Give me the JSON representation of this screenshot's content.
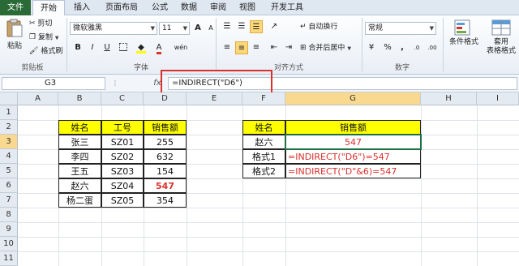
{
  "ribbon_tabs": [
    "文件",
    "开始",
    "插入",
    "页面布局",
    "公式",
    "数据",
    "审阅",
    "视图",
    "开发工具"
  ],
  "clipboard": {
    "paste": "粘贴",
    "cut": "剪切",
    "copy": "复制",
    "format_painter": "格式刷",
    "group_label": "剪贴板"
  },
  "font": {
    "name": "微软雅黑",
    "size": "11",
    "bold": "B",
    "italic": "I",
    "underline": "U",
    "grow": "A",
    "shrink": "A",
    "font_color_glyph": "A",
    "phonetic": "wén",
    "group_label": "字体"
  },
  "alignment": {
    "wrap": "自动换行",
    "merge": "合并后居中",
    "group_label": "对齐方式"
  },
  "number": {
    "format": "常规",
    "currency": "¥",
    "percent": "%",
    "comma": ",",
    "dec_inc": ".0",
    "dec_dec": ".00",
    "group_label": "数字"
  },
  "styles": {
    "conditional": "条件格式",
    "table_line1": "套用",
    "table_line2": "表格格式"
  },
  "formula_bar": {
    "name_box": "G3",
    "fx": "fx",
    "content": "=INDIRECT(\"D6\")"
  },
  "grid": {
    "columns": [
      "A",
      "B",
      "C",
      "D",
      "E",
      "F",
      "G",
      "H",
      "I"
    ],
    "rows": [
      "1",
      "2",
      "3",
      "4",
      "5",
      "6",
      "7",
      "8",
      "9",
      "10",
      "11"
    ],
    "active_cell": "G3"
  },
  "table1": {
    "headers": [
      "姓名",
      "工号",
      "销售额"
    ],
    "rows": [
      [
        "张三",
        "SZ01",
        "255"
      ],
      [
        "李四",
        "SZ02",
        "632"
      ],
      [
        "王五",
        "SZ03",
        "154"
      ],
      [
        "赵六",
        "SZ04",
        "547"
      ],
      [
        "杨二蛋",
        "SZ05",
        "354"
      ]
    ]
  },
  "table2": {
    "headers": [
      "姓名",
      "销售额"
    ],
    "rows": [
      [
        "赵六",
        "547"
      ],
      [
        "格式1",
        "=INDIRECT(\"D6\")=547"
      ],
      [
        "格式2",
        "=INDIRECT(\"D\"&6)=547"
      ]
    ]
  },
  "colors": {
    "file_tab": "#2a6a37",
    "header_fill": "#ffff00",
    "highlight_text": "#d9302c",
    "selection": "#1e7145"
  }
}
